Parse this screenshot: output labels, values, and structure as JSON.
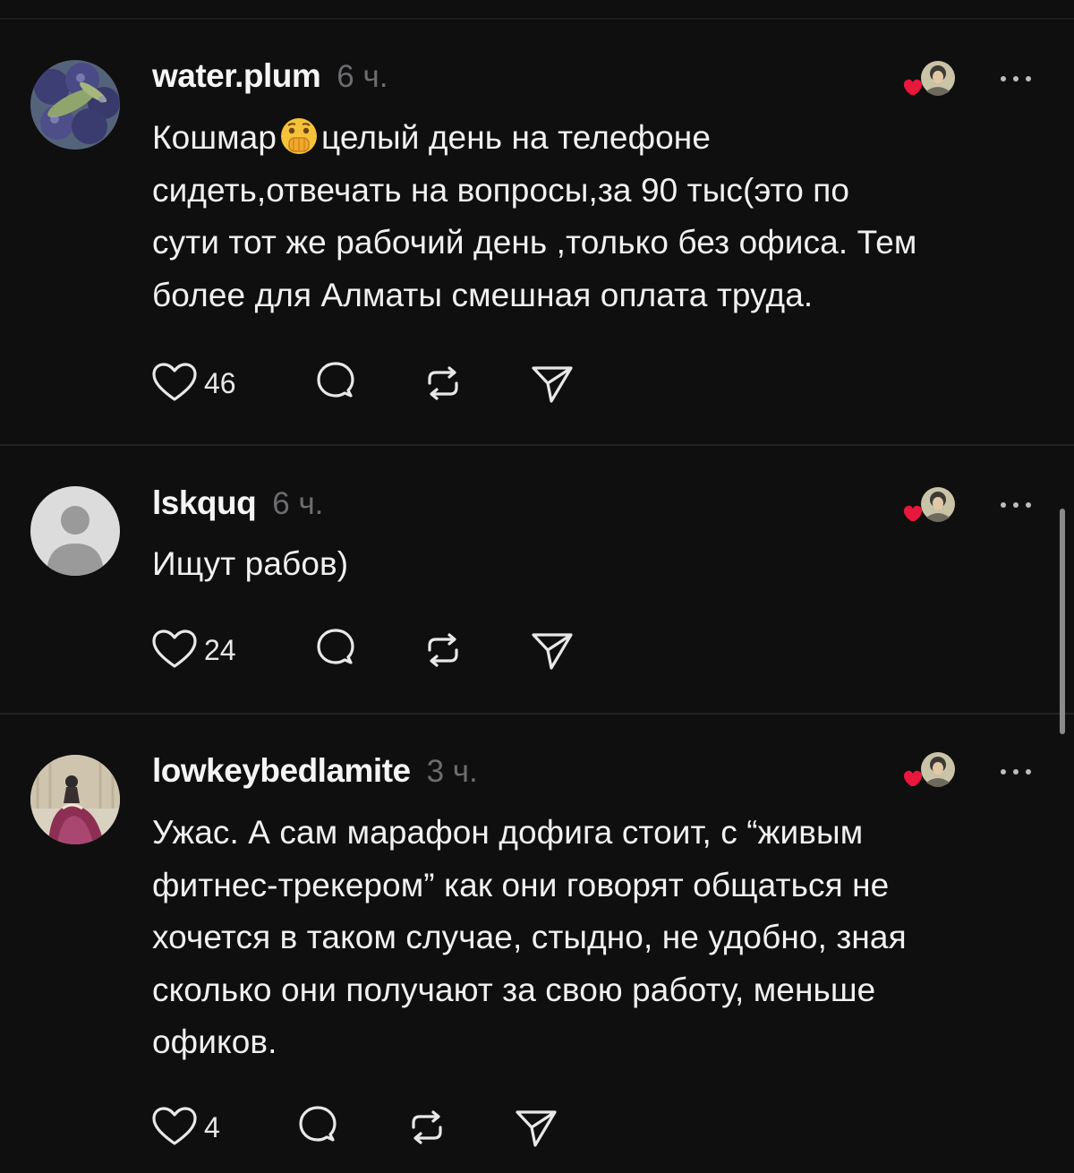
{
  "posts": [
    {
      "username": "water.plum",
      "time": "6 ч.",
      "text_before_emoji": "Кошмар",
      "emoji": "face-with-hand-over-mouth",
      "text_after_emoji": "целый день на телефоне\nсидеть,отвечать на вопросы,за 90 тыс(это по\nсути тот же рабочий день ,только без офиса. Тем\nболее для Алматы смешная оплата труда.",
      "likes": "46"
    },
    {
      "username": "lskquq",
      "time": "6 ч.",
      "text": "Ищут рабов)",
      "likes": "24"
    },
    {
      "username": "lowkeybedlamite",
      "time": "3 ч.",
      "text": "Ужас. А сам марафон дофига стоит, с “живым\nфитнес-трекером” как они говорят общаться не\nхочется в таком случае, стыдно, не удобно, зная\nсколько они получают за свою работу, меньше\nофиков.",
      "likes": "4"
    }
  ],
  "icons": {
    "like": "heart-outline-icon",
    "reply": "speech-bubble-icon",
    "repost": "repost-arrows-icon",
    "share": "paper-plane-icon",
    "more": "ellipsis-icon",
    "liked_by_author": "author-avatar-with-red-heart"
  },
  "colors": {
    "background": "#0f0f10",
    "text": "#f1f1f1",
    "muted": "#6d6d70",
    "heart": "#e8173c",
    "divider": "#222224"
  }
}
